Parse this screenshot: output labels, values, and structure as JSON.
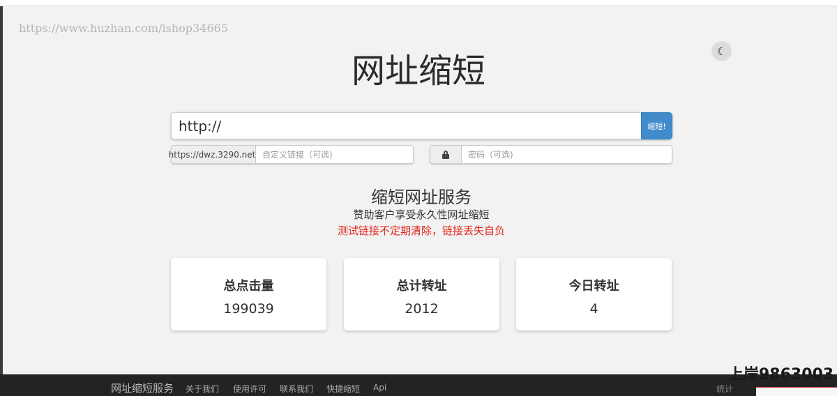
{
  "watermark": "https://www.huzhan.com/ishop34665",
  "header": {
    "title": "网址缩短",
    "theme_icon": "moon-icon",
    "theme_glyph": "☾"
  },
  "shortener": {
    "url_value": "http://",
    "button_label": "缩短!",
    "domain_prefix": "https://dwz.3290.net/",
    "custom_placeholder": "自定义链接（可选)",
    "password_placeholder": "密码（可选)",
    "lock_icon": "lock-icon"
  },
  "service": {
    "title": "缩短网址服务",
    "subtitle": "赞助客户享受永久性网址缩短",
    "warning": "测试链接不定期清除，链接丢失自负",
    "warning_color": "#e0241c"
  },
  "stats": [
    {
      "label": "总点击量",
      "value": "199039"
    },
    {
      "label": "总计转址",
      "value": "2012"
    },
    {
      "label": "今日转址",
      "value": "4"
    }
  ],
  "footer": {
    "brand": "网址缩短服务",
    "nav": [
      {
        "label": "关于我们"
      },
      {
        "label": "使用许可"
      },
      {
        "label": "联系我们"
      },
      {
        "label": "快捷缩短"
      },
      {
        "label": "Api"
      }
    ],
    "stats_label": "统计"
  },
  "overlay_text": "上岸9863003",
  "colors": {
    "accent_button": "#428bca",
    "footer_bg": "#232323",
    "page_bg": "#f2f2f2"
  }
}
